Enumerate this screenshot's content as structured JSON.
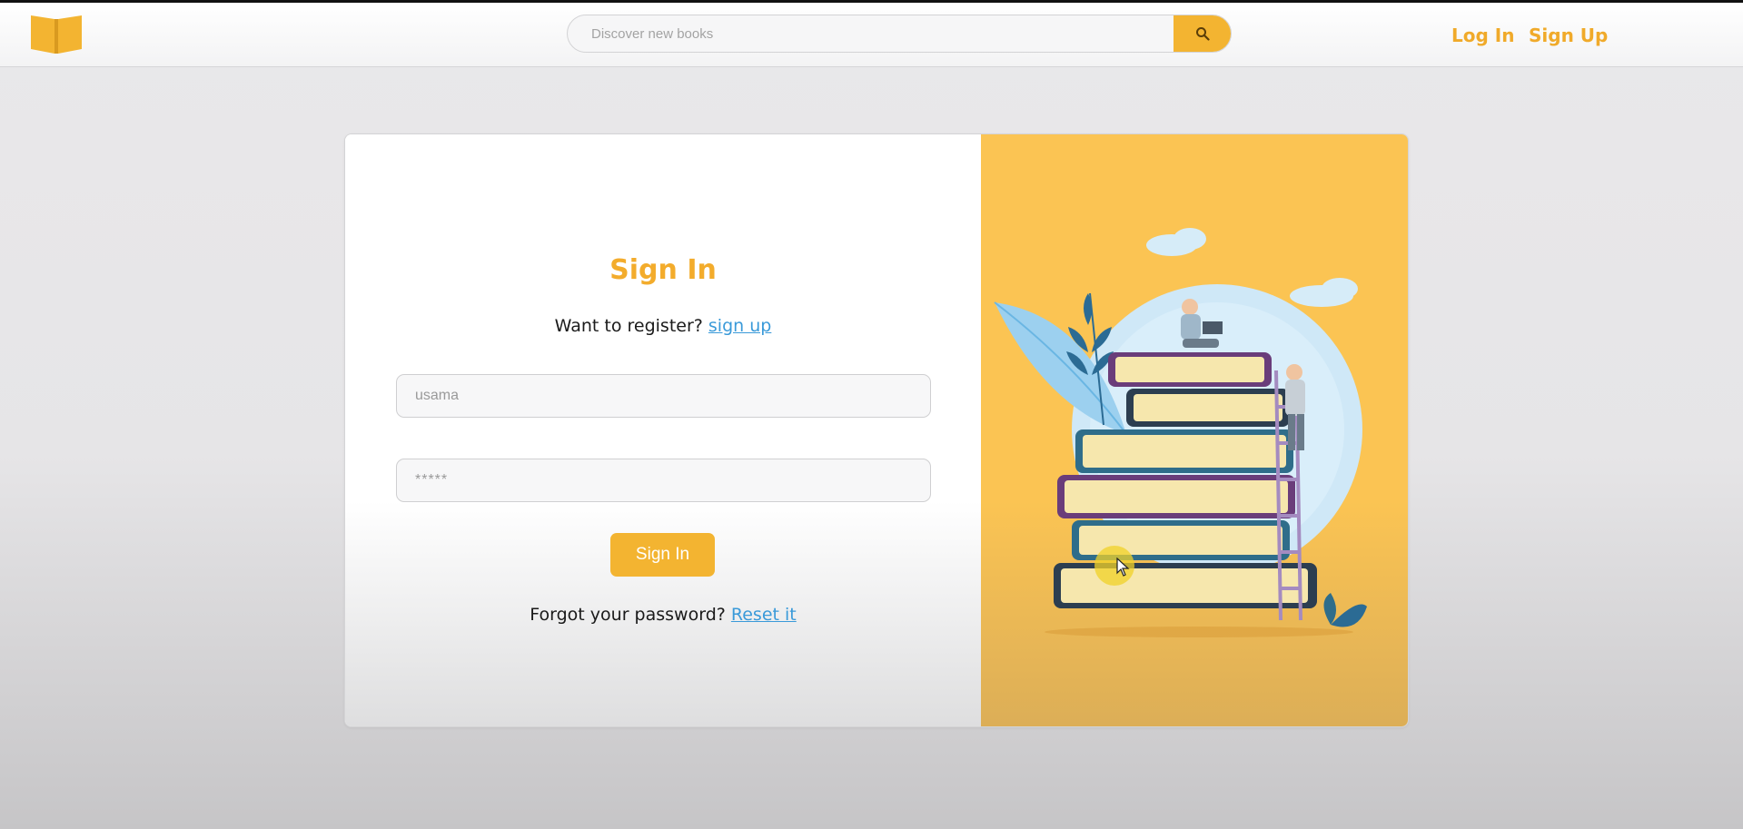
{
  "nav": {
    "search_placeholder": "Discover new books",
    "login_label": "Log In",
    "signup_label": "Sign Up",
    "icons": {
      "logo": "open-book-icon",
      "search": "magnifier-icon"
    },
    "accent_color": "#f3b431"
  },
  "form": {
    "title": "Sign In",
    "register_prompt": "Want to register?",
    "register_link": "sign up",
    "username_value": "usama",
    "password_value": "*****",
    "submit_label": "Sign In",
    "forgot_prompt": "Forgot your password?",
    "reset_link": "Reset it",
    "link_color": "#3a9ad9"
  },
  "illustration": {
    "description_icon": "stacked-books-reading-illustration",
    "background_color": "#fbc453"
  }
}
